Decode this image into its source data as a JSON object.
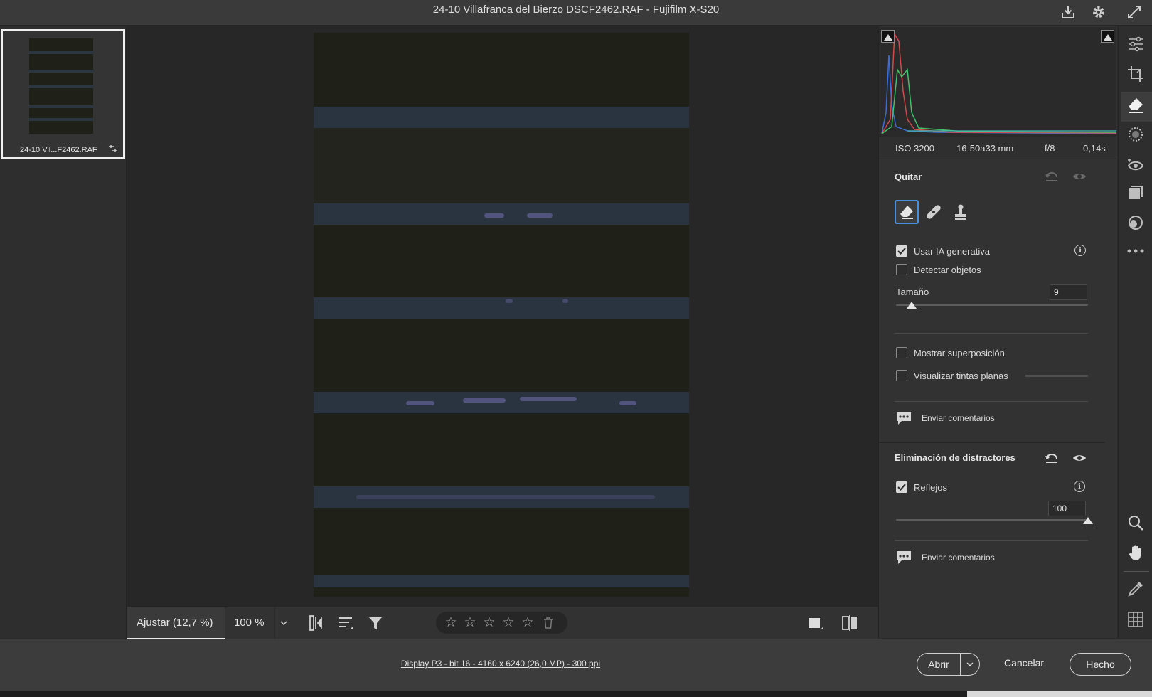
{
  "window": {
    "title": "24-10 Villafranca del Bierzo DSCF2462.RAF -  Fujifilm X-S20"
  },
  "filmstrip": {
    "items": [
      {
        "name": "24-10 Vil...F2462.RAF",
        "selected": true
      }
    ]
  },
  "canvas_toolbar": {
    "zoom_fit_label": "Ajustar (12,7 %)",
    "zoom_100_label": "100 %",
    "rating_stars": 0,
    "star_glyph": "☆"
  },
  "histogram": {
    "iso": "ISO 3200",
    "lens": "16-50a33 mm",
    "aperture": "f/8",
    "shutter": "0,14s"
  },
  "remove_panel": {
    "title": "Quitar",
    "tools": [
      "eraser-icon",
      "bandage-icon",
      "stamp-icon"
    ],
    "active_tool": "eraser-icon",
    "use_generative_ai": {
      "label": "Usar IA generativa",
      "checked": true
    },
    "detect_objects": {
      "label": "Detectar objetos",
      "checked": false
    },
    "size": {
      "label": "Tamaño",
      "value": "9",
      "fraction": 0.08
    },
    "show_overlay": {
      "label": "Mostrar superposición",
      "checked": false
    },
    "visualize_flat_tints": {
      "label": "Visualizar tintas planas",
      "checked": false
    },
    "feedback_label": "Enviar comentarios"
  },
  "distraction_panel": {
    "title": "Eliminación de distractores",
    "reflections": {
      "label": "Reflejos",
      "checked": true,
      "value": "100",
      "fraction": 1.0
    },
    "feedback_label": "Enviar comentarios"
  },
  "footer": {
    "info_link": "Display P3 - bit 16 - 4160 x 6240 (26,0 MP) - 300 ppi",
    "open_label": "Abrir",
    "cancel_label": "Cancelar",
    "done_label": "Hecho"
  },
  "colors": {
    "accent_blue": "#4a90e2",
    "panel_bg": "#323232",
    "canvas_bg": "#272727"
  }
}
